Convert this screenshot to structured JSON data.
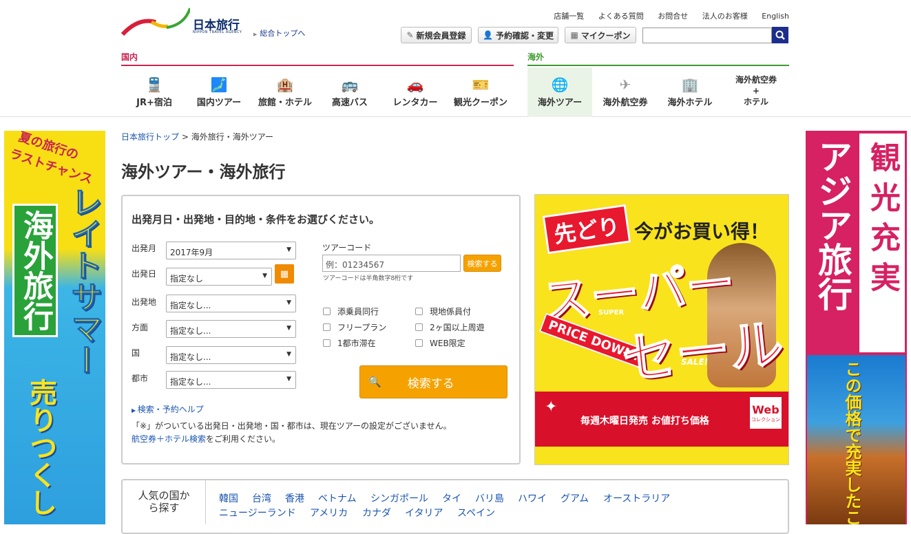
{
  "header": {
    "logo_text": "日本旅行",
    "logo_sub": "NIPPON TRAVEL AGENCY",
    "top_link": "総合トップへ",
    "util_links": [
      "店舗一覧",
      "よくある質問",
      "お問合せ",
      "法人のお客様",
      "English"
    ],
    "buttons": {
      "register": "新規会員登録",
      "reservation": "予約確認・変更",
      "coupon": "マイクーポン"
    },
    "search_placeholder": ""
  },
  "nav": {
    "domestic_label": "国内",
    "overseas_label": "海外",
    "domestic_items": [
      "JR+宿泊",
      "国内ツアー",
      "旅館・ホテル",
      "高速バス",
      "レンタカー",
      "観光クーポン"
    ],
    "overseas_items": [
      "海外ツアー",
      "海外航空券",
      "海外ホテル"
    ],
    "air_hotel": {
      "line1": "海外航空券",
      "line2": "+",
      "line3": "ホテル"
    }
  },
  "breadcrumb": {
    "home": "日本旅行トップ",
    "sep": ">",
    "current": "海外旅行・海外ツアー"
  },
  "page_title": "海外ツアー・海外旅行",
  "search": {
    "heading": "出発月日・出発地・目的地・条件をお選びください。",
    "fields": [
      {
        "label": "出発月",
        "value": "2017年9月"
      },
      {
        "label": "出発日",
        "value": "指定なし"
      },
      {
        "label": "出発地",
        "value": "指定なし..."
      },
      {
        "label": "方面",
        "value": "指定なし..."
      },
      {
        "label": "国",
        "value": "指定なし..."
      },
      {
        "label": "都市",
        "value": "指定なし..."
      }
    ],
    "tour_code_label": "ツアーコード",
    "tour_code_placeholder": "例：01234567",
    "tour_code_button": "検索する",
    "tour_code_note": "ツアーコードは半角数字8桁です",
    "checkboxes": [
      "添乗員同行",
      "現地係員付",
      "フリープラン",
      "2ヶ国以上周遊",
      "1都市滞在",
      "WEB限定"
    ],
    "search_button": "検索する",
    "help_link": "検索・予約ヘルプ",
    "note_line1": "「※」がついている出発日・出発地・国・都市は、現在ツアーの設定がございません。",
    "note_link": "航空券＋ホテル検索",
    "note_line2_rest": "をご利用ください。"
  },
  "ad_main": {
    "tag": "先どり",
    "headline": "今がお買い得！",
    "big1": "スーパー",
    "big2": "セール",
    "super": "SUPER",
    "sale": "SALE!",
    "price_down": "PRICE DOWN!",
    "footer": "毎週木曜日発売 お値打ち価格",
    "web": "Web",
    "web_sub": "コレクション"
  },
  "ad_left": {
    "top1": "夏の旅行の",
    "top2": "ラストチャンス",
    "vert_big": "レイトサマー",
    "vert_green": "海外旅行",
    "vert_bottom": "売りつくし"
  },
  "ad_right": {
    "col1": "アジア旅行",
    "col2": "観光充実",
    "bottom": "この価格で充実したこの"
  },
  "popular": {
    "title": "人気の国から探す",
    "row1": [
      "韓国",
      "台湾",
      "香港",
      "ベトナム",
      "シンガポール",
      "タイ",
      "バリ島",
      "ハワイ",
      "グアム",
      "オーストラリア"
    ],
    "row2": [
      "ニュージーランド",
      "アメリカ",
      "カナダ",
      "イタリア",
      "スペイン"
    ]
  },
  "colors": {
    "domestic": "#c8244f",
    "overseas": "#3d9a2e",
    "orange": "#f5a200",
    "navy": "#1c2e8c",
    "link": "#1a55b0"
  }
}
